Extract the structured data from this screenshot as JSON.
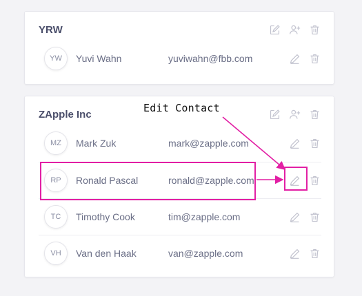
{
  "groups": [
    {
      "title": "YRW",
      "contacts": [
        {
          "initials": "YW",
          "name": "Yuvi Wahn",
          "email": "yuviwahn@fbb.com"
        }
      ]
    },
    {
      "title": "ZApple Inc",
      "contacts": [
        {
          "initials": "MZ",
          "name": "Mark Zuk",
          "email": "mark@zapple.com"
        },
        {
          "initials": "RP",
          "name": "Ronald Pascal",
          "email": "ronald@zapple.com"
        },
        {
          "initials": "TC",
          "name": "Timothy Cook",
          "email": "tim@zapple.com"
        },
        {
          "initials": "VH",
          "name": "Van den Haak",
          "email": "van@zapple.com"
        }
      ]
    }
  ],
  "annotation": {
    "text": "Edit Contact"
  },
  "colors": {
    "annotation": "#e21fa4",
    "icon": "#c2c3cf",
    "text": "#6a6e86",
    "title": "#4a4e6a"
  },
  "icons": {
    "group_actions": [
      "edit-square-icon",
      "add-user-icon",
      "trash-icon"
    ],
    "row_actions": [
      "pencil-icon",
      "trash-icon"
    ]
  }
}
